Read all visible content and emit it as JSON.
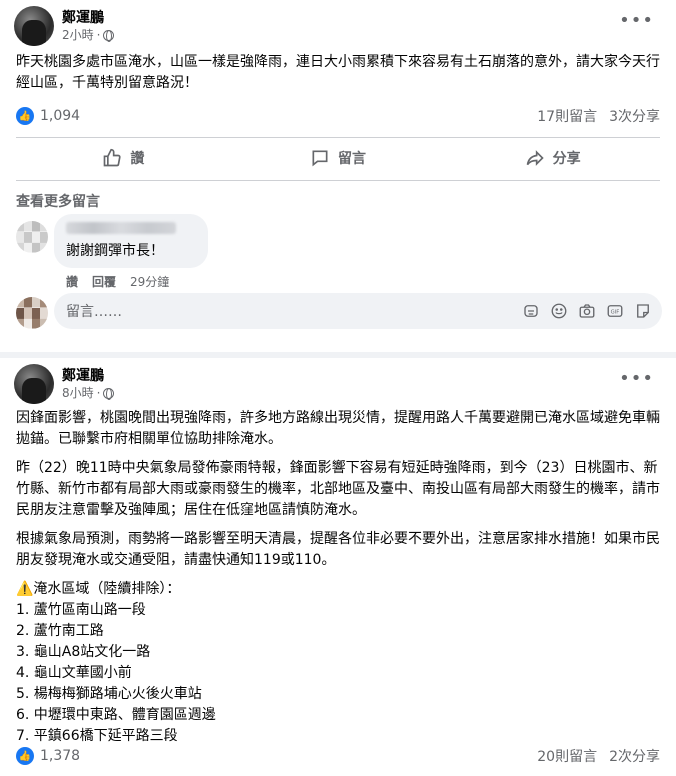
{
  "post1": {
    "author": "鄭運鵬",
    "time": "2小時",
    "text": "昨天桃園多處市區淹水，山區一樣是強降雨，連日大小雨累積下來容易有土石崩落的意外，請大家今天行經山區，千萬特別留意路況！",
    "like_count": "1,094",
    "comments_count": "17則留言",
    "shares_count": "3次分享",
    "actions": {
      "like": "讚",
      "comment": "留言",
      "share": "分享"
    },
    "see_more_comments": "查看更多留言",
    "comment": {
      "text": "謝謝鋼彈市長！",
      "like": "讚",
      "reply": "回覆",
      "time": "29分鐘"
    },
    "composer_placeholder": "留言……"
  },
  "post2": {
    "author": "鄭運鵬",
    "time": "8小時",
    "paragraphs": [
      "因鋒面影響，桃園晚間出現強降雨，許多地方路線出現災情，提醒用路人千萬要避開已淹水區域避免車輛拋錨。已聯繫市府相關單位協助排除淹水。",
      "昨（22）晚11時中央氣象局發佈豪雨特報，鋒面影響下容易有短延時強降雨，到今（23）日桃園市、新竹縣、新竹市都有局部大雨或豪雨發生的機率，北部地區及臺中、南投山區有局部大雨發生的機率，請市民朋友注意雷擊及強陣風；居住在低窪地區請慎防淹水。",
      "根據氣象局預測，雨勢將一路影響至明天清晨，提醒各位非必要不要外出，注意居家排水措施！如果市民朋友發現淹水或交通受阻，請盡快通知119或110。"
    ],
    "list_title": "⚠️淹水區域（陸續排除）：",
    "list_items": [
      "1. 蘆竹區南山路一段",
      "2. 蘆竹南工路",
      "3. 龜山A8站文化一路",
      "4. 龜山文華國小前",
      "5. 楊梅梅獅路埔心火後火車站",
      "6. 中壢環中東路、體育園區週邊",
      "7. 平鎮66橋下延平路三段"
    ],
    "like_count": "1,378",
    "comments_count": "20則留言",
    "shares_count": "2次分享"
  },
  "icons": {
    "more": "more-options-icon",
    "globe": "globe-icon",
    "like": "thumbs-up-icon",
    "comment": "comment-icon",
    "share": "share-icon"
  },
  "colors": {
    "accent": "#1877f2",
    "muted": "#65676b",
    "background": "#f0f2f5"
  }
}
